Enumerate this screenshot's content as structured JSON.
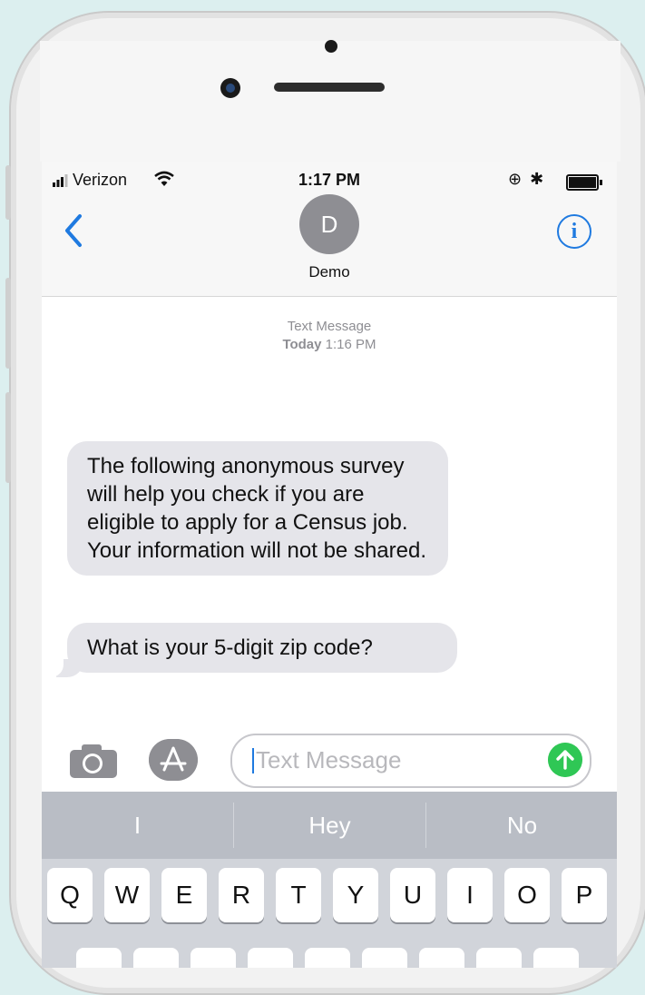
{
  "status_bar": {
    "carrier": "Verizon",
    "time": "1:17 PM"
  },
  "contact": {
    "initial": "D",
    "name": "Demo"
  },
  "thread": {
    "label": "Text Message",
    "day": "Today",
    "time": "1:16 PM"
  },
  "messages": [
    {
      "text": "The following anonymous survey will help you check if you are eligible to apply for a Census job. Your information will not be shared."
    },
    {
      "text": "What is your 5-digit zip code?"
    }
  ],
  "compose": {
    "placeholder": "Text Message"
  },
  "keyboard": {
    "suggestions": [
      "I",
      "Hey",
      "No"
    ],
    "row1": [
      "Q",
      "W",
      "E",
      "R",
      "T",
      "Y",
      "U",
      "I",
      "O",
      "P"
    ]
  },
  "colors": {
    "accent": "#1f7ae0",
    "send": "#2fc755",
    "bubble": "#e5e5ea"
  },
  "icons": {
    "back": "chevron-left-icon",
    "info": "info-icon",
    "camera": "camera-icon",
    "apps": "app-store-icon",
    "send": "arrow-up-icon"
  }
}
